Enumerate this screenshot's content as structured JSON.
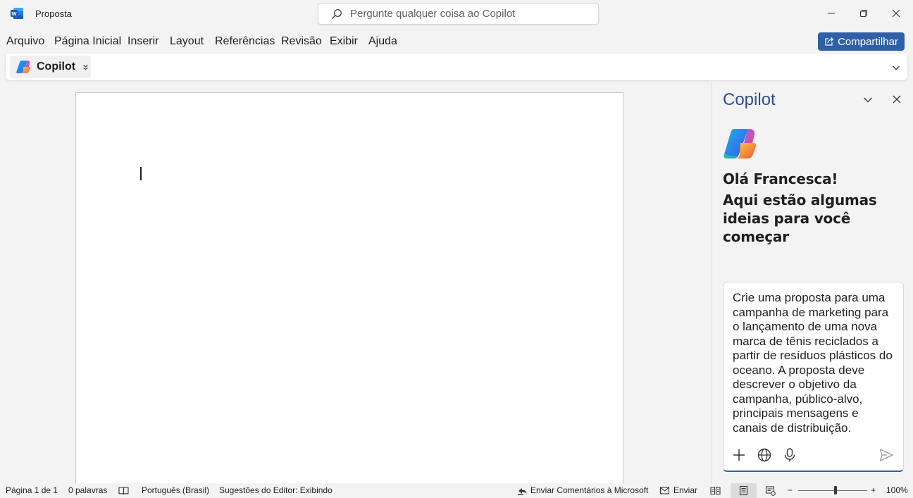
{
  "window": {
    "doc_title": "Proposta",
    "search_placeholder": "Pergunte qualquer coisa ao Copilot"
  },
  "menu": {
    "items": [
      "Arquivo",
      "Página Inicial",
      "Inserir",
      "Layout",
      "Referências",
      "Revisão",
      "Exibir",
      "Ajuda"
    ],
    "share_label": "Compartilhar"
  },
  "ribbon": {
    "copilot_label": "Copilot"
  },
  "pane": {
    "title": "Copilot",
    "greeting": "Olá Francesca!",
    "intro": "Aqui estão algumas ideias para você começar",
    "prompt": "Crie uma proposta para uma campanha de marketing para o lançamento de uma nova marca de tênis reciclados a partir de resíduos plásticos do oceano. A proposta deve descrever o objetivo da campanha, público-alvo, principais mensagens e canais de distribuição."
  },
  "status": {
    "page": "Página 1 de 1",
    "words": "0 palavras",
    "language": "Português (Brasil)",
    "editor": "Sugestões do Editor: Exibindo",
    "feedback": "Enviar Comentários à Microsoft",
    "send": "Enviar",
    "zoom": "100%",
    "zoom_minus": "−",
    "zoom_plus": "+"
  },
  "colors": {
    "accent": "#2e5fa7",
    "pane_title": "#2b4d8a"
  }
}
